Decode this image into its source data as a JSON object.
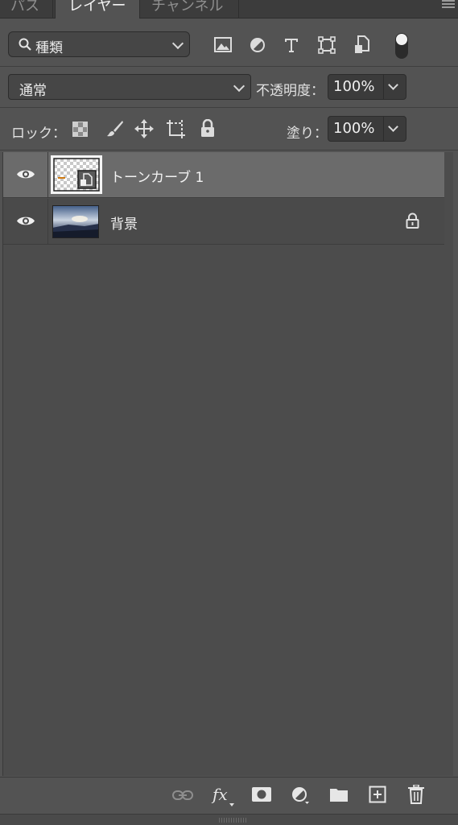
{
  "tabs": [
    {
      "label": "パス"
    },
    {
      "label": "レイヤー"
    },
    {
      "label": "チャンネル"
    }
  ],
  "filter": {
    "selected": "種類"
  },
  "blend": {
    "mode": "通常",
    "opacity_label": "不透明度：",
    "opacity_value": "100%"
  },
  "lock": {
    "label": "ロック：",
    "fill_label": "塗り：",
    "fill_value": "100%"
  },
  "layers": [
    {
      "name": "トーンカーブ 1",
      "visible": true,
      "selected": true,
      "type": "adjustment"
    },
    {
      "name": "背景",
      "visible": true,
      "selected": false,
      "locked": true,
      "type": "image"
    }
  ],
  "colors": {
    "panel": "#535353",
    "list": "#4c4c4c",
    "selected_row": "#6b6b6b"
  },
  "footer_icons": [
    "link-icon",
    "fx-icon",
    "add-mask-icon",
    "adjustment-icon",
    "folder-icon",
    "new-layer-icon",
    "trash-icon"
  ]
}
